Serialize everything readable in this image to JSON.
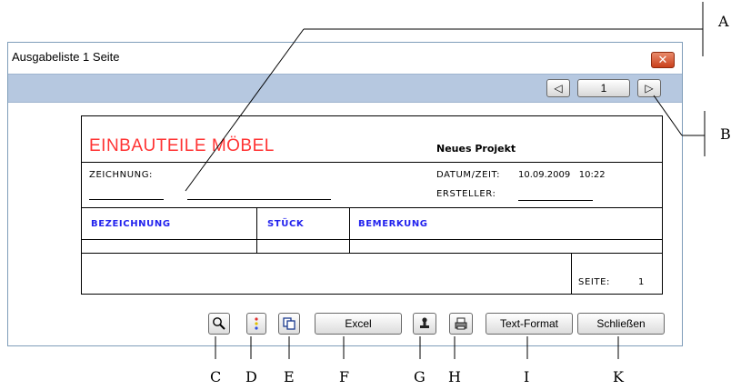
{
  "window": {
    "title": "Ausgabeliste 1 Seite",
    "close_label": "✕"
  },
  "pager": {
    "prev_label": "◁",
    "page_value": "1",
    "next_label": "▷"
  },
  "report": {
    "heading": "EINBAUTEILE MÖBEL",
    "project": "Neues Projekt",
    "drawing_label": "ZEICHNUNG:",
    "datetime_label": "DATUM/ZEIT:",
    "datetime_value": "10.09.2009   10:22",
    "creator_label": "ERSTELLER:",
    "columns": [
      "BEZEICHNUNG",
      "STÜCK",
      "BEMERKUNG"
    ],
    "page_label": "SEITE:",
    "page_value": "1",
    "heading_color": "#ff3333",
    "column_color": "#2222ee"
  },
  "toolbar": {
    "zoom_icon": "magnifier-icon",
    "color_icon": "colored-dots-icon",
    "copy_icon": "copy-pages-icon",
    "excel_label": "Excel",
    "stamp_icon": "stamp-icon",
    "print_icon": "printer-icon",
    "textformat_label": "Text-Format",
    "close_label": "Schließen"
  },
  "callouts": {
    "A": "A",
    "B": "B",
    "C": "C",
    "D": "D",
    "E": "E",
    "F": "F",
    "G": "G",
    "H": "H",
    "I": "I",
    "K": "K"
  }
}
